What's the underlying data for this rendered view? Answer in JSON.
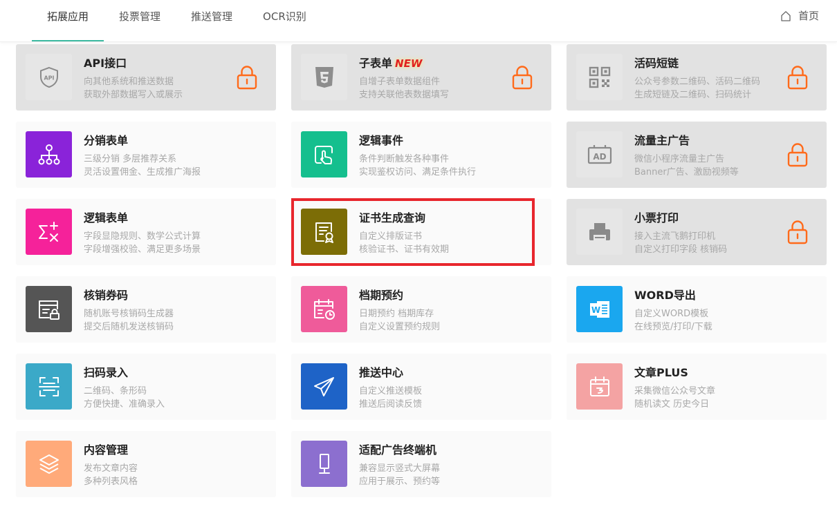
{
  "nav": {
    "tabs": [
      {
        "label": "拓展应用",
        "active": true
      },
      {
        "label": "投票管理"
      },
      {
        "label": "推送管理"
      },
      {
        "label": "OCR识别"
      }
    ],
    "home_label": "首页"
  },
  "cards": [
    {
      "title": "API接口",
      "desc1": "向其他系统和推送数据",
      "desc2": "获取外部数据写入或展示",
      "icon": "api-icon",
      "locked": true
    },
    {
      "title": "子表单",
      "badge": "NEW",
      "desc1": "自增子表单数据组件",
      "desc2": "支持关联他表数据填写",
      "icon": "html5-icon",
      "locked": true
    },
    {
      "title": "活码短链",
      "desc1": "公众号参数二维码、活码二维码",
      "desc2": "生成短链及二维码、扫码统计",
      "icon": "qrcode-icon",
      "locked": true
    },
    {
      "title": "分销表单",
      "desc1": "三级分销 多层推荐关系",
      "desc2": "灵活设置佣金、生成推广海报",
      "icon": "hierarchy-icon",
      "color": "#8a23d9"
    },
    {
      "title": "逻辑事件",
      "desc1": "条件判断触发各种事件",
      "desc2": "实现鉴权访问、满足条件执行",
      "icon": "touch-icon",
      "color": "#15bf8e"
    },
    {
      "title": "流量主广告",
      "desc1": "微信小程序流量主广告",
      "desc2": "Banner广告、激励视频等",
      "icon": "ad-icon",
      "locked": true
    },
    {
      "title": "逻辑表单",
      "desc1": "字段显隐规则、数学公式计算",
      "desc2": "字段增强校验、满足更多场景",
      "icon": "formula-icon",
      "color": "#f5229a"
    },
    {
      "title": "证书生成查询",
      "desc1": "自定义排版证书",
      "desc2": "核验证书、证书有效期",
      "icon": "certificate-icon",
      "color": "#7c6d06"
    },
    {
      "title": "小票打印",
      "desc1": "接入主流飞鹅打印机",
      "desc2": "自定义打印字段 核销码",
      "icon": "printer-icon",
      "locked": true
    },
    {
      "title": "核销券码",
      "desc1": "随机账号核销码生成器",
      "desc2": "提交后随机发送核销码",
      "icon": "coupon-lock-icon",
      "color": "#555555"
    },
    {
      "title": "档期预约",
      "desc1": "日期预约 档期库存",
      "desc2": "自定义设置预约规则",
      "icon": "calendar-clock-icon",
      "color": "#ef5b9a"
    },
    {
      "title": "WORD导出",
      "desc1": "自定义WORD模板",
      "desc2": "在线预览/打印/下载",
      "icon": "word-icon",
      "color": "#1aa7ef"
    },
    {
      "title": "扫码录入",
      "desc1": "二维码、条形码",
      "desc2": "方便快捷、准确录入",
      "icon": "scan-icon",
      "color": "#3ba9c8"
    },
    {
      "title": "推送中心",
      "desc1": "自定义推送模板",
      "desc2": "推送后阅读反馈",
      "icon": "send-icon",
      "color": "#1e63c7"
    },
    {
      "title": "文章PLUS",
      "desc1": "采集微信公众号文章",
      "desc2": "随机读文 历史今日",
      "icon": "article-calendar-icon",
      "color": "#f4a3a3"
    },
    {
      "title": "内容管理",
      "desc1": "发布文章内容",
      "desc2": "多种列表风格",
      "icon": "layers-icon",
      "color": "#ffaa7a"
    },
    {
      "title": "适配广告终端机",
      "desc1": "兼容显示竖式大屏幕",
      "desc2": "应用于展示、预约等",
      "icon": "kiosk-icon",
      "color": "#8c6fcf"
    }
  ],
  "highlight": {
    "target": "证书生成查询",
    "color": "#e8262d"
  }
}
